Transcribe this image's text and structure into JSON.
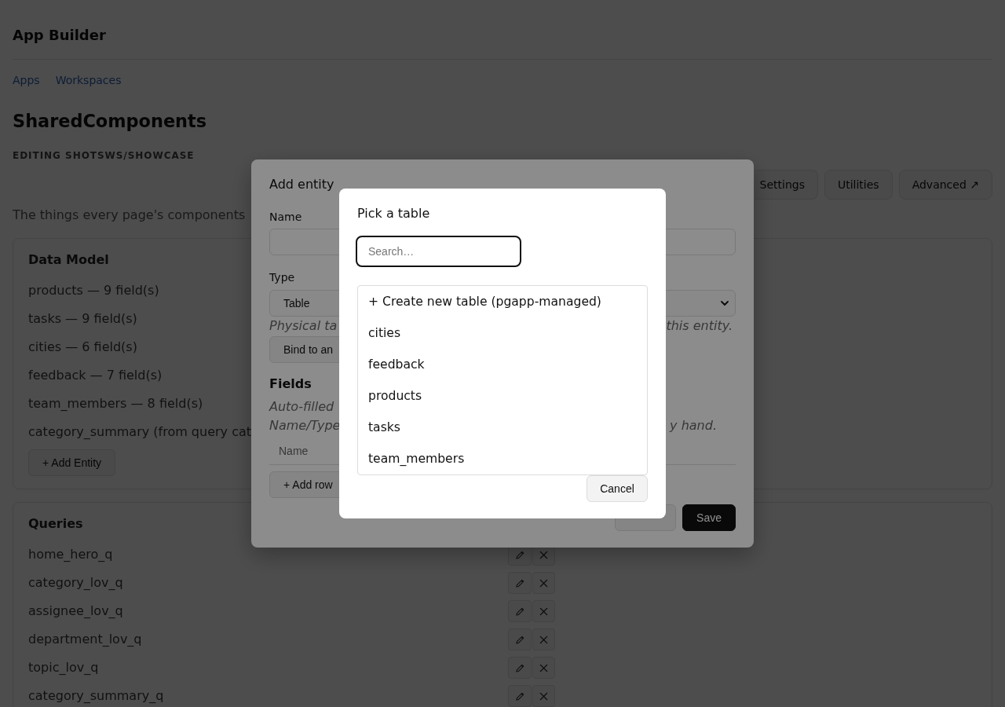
{
  "header": {
    "title": "App Builder"
  },
  "nav": [
    {
      "label": "Apps"
    },
    {
      "label": "Workspaces"
    }
  ],
  "page": {
    "title": "SharedComponents",
    "subtitle": "EDITING SHOTSWS/SHOWCASE",
    "description": "The things every page's components"
  },
  "toolbar": [
    {
      "label": "Settings"
    },
    {
      "label": "Utilities"
    },
    {
      "label": "Advanced ↗"
    }
  ],
  "data_model": {
    "title": "Data Model",
    "entities": [
      "products — 9 field(s)",
      "tasks — 9 field(s)",
      "cities — 6 field(s)",
      "feedback — 7 field(s)",
      "team_members — 8 field(s)",
      "category_summary (from query cat"
    ],
    "add_button": "+ Add Entity"
  },
  "queries": {
    "title": "Queries",
    "items": [
      "home_hero_q",
      "category_lov_q",
      "assignee_lov_q",
      "department_lov_q",
      "topic_lov_q",
      "category_summary_q"
    ]
  },
  "add_entity_dialog": {
    "title": "Add entity",
    "name_field": {
      "label": "Name"
    },
    "type_field": {
      "label": "Type",
      "value": "Table"
    },
    "type_hint": [
      "Physical ta",
      "this entity."
    ],
    "bind_button": "Bind to an",
    "fields": {
      "title": "Fields",
      "hint_lines": [
        [
          "Auto-filled"
        ],
        [
          "Name/Type",
          "y hand."
        ]
      ],
      "columns": [
        "Name"
      ],
      "add_row_button": "+ Add row"
    },
    "buttons": [
      {
        "kind": "secondary"
      },
      {
        "label": "Save",
        "kind": "primary"
      }
    ]
  },
  "table_picker": {
    "title": "Pick a table",
    "search": {
      "placeholder": "Search…",
      "focused": true
    },
    "options": [
      {
        "label": "+ Create new table (pgapp-managed)",
        "selected": false
      },
      {
        "label": "cities",
        "selected": false
      },
      {
        "label": "feedback",
        "selected": false
      },
      {
        "label": "products",
        "selected": false
      },
      {
        "label": "tasks",
        "selected": false
      },
      {
        "label": "team_members",
        "selected": false
      }
    ],
    "cancel_button": "Cancel"
  }
}
